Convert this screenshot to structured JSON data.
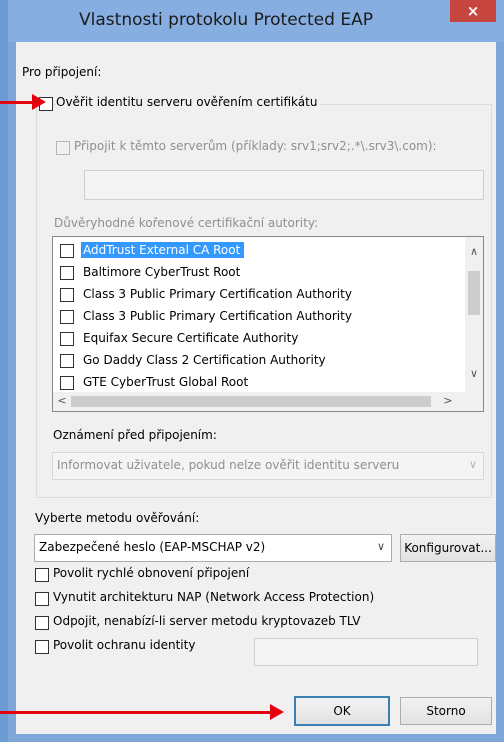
{
  "window": {
    "title": "Vlastnosti protokolu Protected EAP",
    "close_glyph": "×"
  },
  "connection_label": "Pro připojení:",
  "verify_server": {
    "label": "Ověřit identitu serveru ověřením certifikátu",
    "checked": false
  },
  "connect_to_servers": {
    "label": "Připojit k těmto serverům (příklady: srv1;srv2;.*\\.srv3\\.com):",
    "value": ""
  },
  "trusted_ca": {
    "label": "Důvěryhodné kořenové certifikační autority:",
    "items": [
      {
        "label": "AddTrust External CA Root",
        "checked": false,
        "selected": true
      },
      {
        "label": "Baltimore CyberTrust Root",
        "checked": false
      },
      {
        "label": "Class 3 Public Primary Certification Authority",
        "checked": false
      },
      {
        "label": "Class 3 Public Primary Certification Authority",
        "checked": false
      },
      {
        "label": "Equifax Secure Certificate Authority",
        "checked": false
      },
      {
        "label": "Go Daddy Class 2 Certification Authority",
        "checked": false
      },
      {
        "label": "GTE CyberTrust Global Root",
        "checked": false
      }
    ]
  },
  "notify": {
    "label": "Oznámení před připojením:",
    "value": "Informovat uživatele, pokud nelze ověřit identitu serveru"
  },
  "auth_method": {
    "label": "Vyberte metodu ověřování:",
    "value": "Zabezpečené heslo (EAP-MSCHAP v2)",
    "configure_label": "Konfigurovat..."
  },
  "options": [
    {
      "label": "Povolit rychlé obnovení připojení",
      "checked": false
    },
    {
      "label": "Vynutit architekturu NAP (Network Access Protection)",
      "checked": false
    },
    {
      "label": "Odpojit, nenabízí-li server metodu kryptovazeb TLV",
      "checked": false
    },
    {
      "label": "Povolit ochranu identity",
      "checked": false
    }
  ],
  "identity_value": "",
  "buttons": {
    "ok": "OK",
    "cancel": "Storno"
  },
  "icons": {
    "scroll_up": "∧",
    "scroll_down": "∨",
    "scroll_left": "<",
    "scroll_right": ">",
    "dropdown": "∨"
  },
  "colors": {
    "annotation_arrow": "#e3000f",
    "selection": "#3399ff",
    "close_button": "#c7453f"
  }
}
